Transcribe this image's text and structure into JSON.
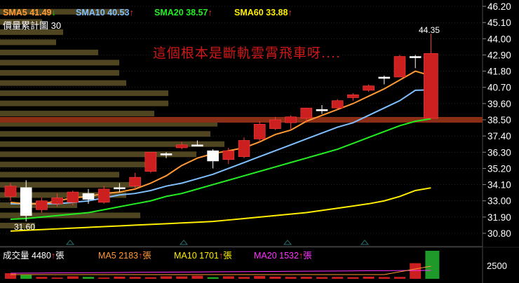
{
  "legend": {
    "sma5": {
      "label": "SMA5",
      "value": "41.49",
      "arrow": "↓",
      "color": "#ff9933",
      "arrow_color": "#00e000"
    },
    "sma10": {
      "label": "SMA10",
      "value": "40.53",
      "arrow": "↑",
      "color": "#7fbfff",
      "arrow_color": "#ff3030"
    },
    "sma20": {
      "label": "SMA20",
      "value": "38.57",
      "arrow": "↑",
      "color": "#22ee22",
      "arrow_color": "#ff3030"
    },
    "sma60": {
      "label": "SMA60",
      "value": "33.88",
      "arrow": "↑",
      "color": "#ffee00",
      "arrow_color": "#ff3030"
    }
  },
  "volume_profile_label": "價量累計圖 30",
  "annotation": "這個根本是斷軌雲霄飛車呀....",
  "high_label": "44.35",
  "low_label": "31.60",
  "price_axis": {
    "ticks": [
      "46.20",
      "45.10",
      "44.00",
      "42.90",
      "41.80",
      "40.70",
      "39.60",
      "38.50",
      "37.40",
      "36.30",
      "35.20",
      "34.10",
      "33.00",
      "31.90",
      "30.80"
    ]
  },
  "volume_legend": {
    "vol": {
      "label": "成交量",
      "value": "4480",
      "arrow": "↑",
      "unit": "張"
    },
    "ma5": {
      "label": "MA5",
      "value": "2183",
      "arrow": "↑",
      "unit": "張",
      "color": "#ff9933"
    },
    "ma10": {
      "label": "MA10",
      "value": "1701",
      "arrow": "↑",
      "unit": "張",
      "color": "#ffee00"
    },
    "ma20": {
      "label": "MA20",
      "value": "1532",
      "arrow": "↑",
      "unit": "張",
      "color": "#ff33ff"
    }
  },
  "volume_axis": {
    "tick": "2500"
  },
  "colors": {
    "up": "#cc1f1f",
    "down": "#ffffff",
    "profile": "#4f4520",
    "profile_highlight": "#8b2e16",
    "grid": "#3a3a3a"
  },
  "chart_data": {
    "type": "candlestick",
    "ylim": [
      30.8,
      46.2
    ],
    "candles": [
      {
        "o": 33.3,
        "h": 34.2,
        "l": 33.0,
        "c": 34.0
      },
      {
        "o": 33.9,
        "h": 34.4,
        "l": 31.6,
        "c": 32.0
      },
      {
        "o": 32.4,
        "h": 33.2,
        "l": 32.2,
        "c": 33.0
      },
      {
        "o": 32.8,
        "h": 33.5,
        "l": 32.6,
        "c": 33.2
      },
      {
        "o": 32.9,
        "h": 33.7,
        "l": 32.7,
        "c": 33.6
      },
      {
        "o": 33.5,
        "h": 33.8,
        "l": 32.8,
        "c": 33.1
      },
      {
        "o": 32.9,
        "h": 34.0,
        "l": 32.8,
        "c": 33.8
      },
      {
        "o": 33.9,
        "h": 34.2,
        "l": 33.6,
        "c": 33.9
      },
      {
        "o": 34.0,
        "h": 34.9,
        "l": 33.8,
        "c": 34.6
      },
      {
        "o": 35.0,
        "h": 36.3,
        "l": 34.9,
        "c": 36.3
      },
      {
        "o": 36.2,
        "h": 36.3,
        "l": 35.9,
        "c": 36.2
      },
      {
        "o": 36.6,
        "h": 37.0,
        "l": 36.5,
        "c": 36.8
      },
      {
        "o": 36.8,
        "h": 37.1,
        "l": 36.7,
        "c": 36.8
      },
      {
        "o": 36.4,
        "h": 36.5,
        "l": 35.2,
        "c": 35.7
      },
      {
        "o": 35.8,
        "h": 36.6,
        "l": 35.5,
        "c": 36.4
      },
      {
        "o": 36.0,
        "h": 37.3,
        "l": 35.9,
        "c": 37.1
      },
      {
        "o": 37.2,
        "h": 38.4,
        "l": 37.0,
        "c": 38.2
      },
      {
        "o": 37.9,
        "h": 38.7,
        "l": 37.8,
        "c": 38.5
      },
      {
        "o": 38.3,
        "h": 38.8,
        "l": 37.8,
        "c": 38.7
      },
      {
        "o": 38.6,
        "h": 39.3,
        "l": 38.3,
        "c": 39.3
      },
      {
        "o": 39.2,
        "h": 39.5,
        "l": 38.9,
        "c": 39.2
      },
      {
        "o": 39.3,
        "h": 39.9,
        "l": 39.2,
        "c": 39.8
      },
      {
        "o": 40.0,
        "h": 40.3,
        "l": 39.8,
        "c": 40.2
      },
      {
        "o": 40.5,
        "h": 40.9,
        "l": 40.4,
        "c": 40.8
      },
      {
        "o": 41.4,
        "h": 41.5,
        "l": 40.9,
        "c": 41.4
      },
      {
        "o": 41.4,
        "h": 42.9,
        "l": 41.4,
        "c": 42.8
      },
      {
        "o": 42.8,
        "h": 42.9,
        "l": 42.0,
        "c": 42.8
      },
      {
        "o": 38.6,
        "h": 44.35,
        "l": 38.6,
        "c": 43.0
      }
    ],
    "sma5": [
      32.9,
      32.8,
      32.8,
      33.0,
      33.2,
      33.3,
      33.5,
      33.6,
      33.8,
      34.2,
      34.7,
      35.4,
      35.9,
      36.2,
      36.4,
      36.6,
      37.0,
      37.5,
      37.8,
      38.4,
      38.8,
      39.2,
      39.6,
      40.1,
      40.6,
      41.2,
      41.8,
      41.49
    ],
    "sma10": [
      32.8,
      32.8,
      32.8,
      32.8,
      32.9,
      33.0,
      33.2,
      33.4,
      33.5,
      33.7,
      34.0,
      34.2,
      34.5,
      34.8,
      35.2,
      35.6,
      36.0,
      36.4,
      36.8,
      37.2,
      37.6,
      38.0,
      38.3,
      38.8,
      39.3,
      39.8,
      40.5,
      40.53
    ],
    "sma20": [
      31.75,
      31.8,
      31.9,
      32.0,
      32.1,
      32.2,
      32.4,
      32.6,
      32.8,
      33.0,
      33.3,
      33.5,
      33.8,
      34.1,
      34.4,
      34.7,
      35.0,
      35.3,
      35.6,
      35.9,
      36.2,
      36.5,
      36.9,
      37.3,
      37.7,
      38.1,
      38.4,
      38.57
    ],
    "sma60": [
      30.95,
      31.0,
      31.05,
      31.1,
      31.15,
      31.2,
      31.25,
      31.3,
      31.35,
      31.4,
      31.45,
      31.5,
      31.55,
      31.6,
      31.7,
      31.8,
      31.9,
      32.0,
      32.1,
      32.2,
      32.35,
      32.5,
      32.65,
      32.8,
      33.0,
      33.3,
      33.7,
      33.88
    ],
    "volume_profile": [
      1.8,
      0.6,
      0.9,
      0.8,
      1.4,
      1.7,
      1.7,
      1.8,
      2.4,
      2.4,
      2.2,
      3.1,
      3.0,
      3.2,
      2.8,
      2.2,
      1.7,
      2.0,
      1.8,
      1.1,
      2.0,
      0.5
    ],
    "volume_highlight_price": 38.5,
    "volume": [
      900,
      600,
      300,
      200,
      400,
      300,
      200,
      350,
      300,
      250,
      400,
      380,
      500,
      250,
      400,
      300,
      450,
      350,
      300,
      320,
      280,
      300,
      260,
      340,
      280,
      300,
      2500,
      4480
    ]
  }
}
